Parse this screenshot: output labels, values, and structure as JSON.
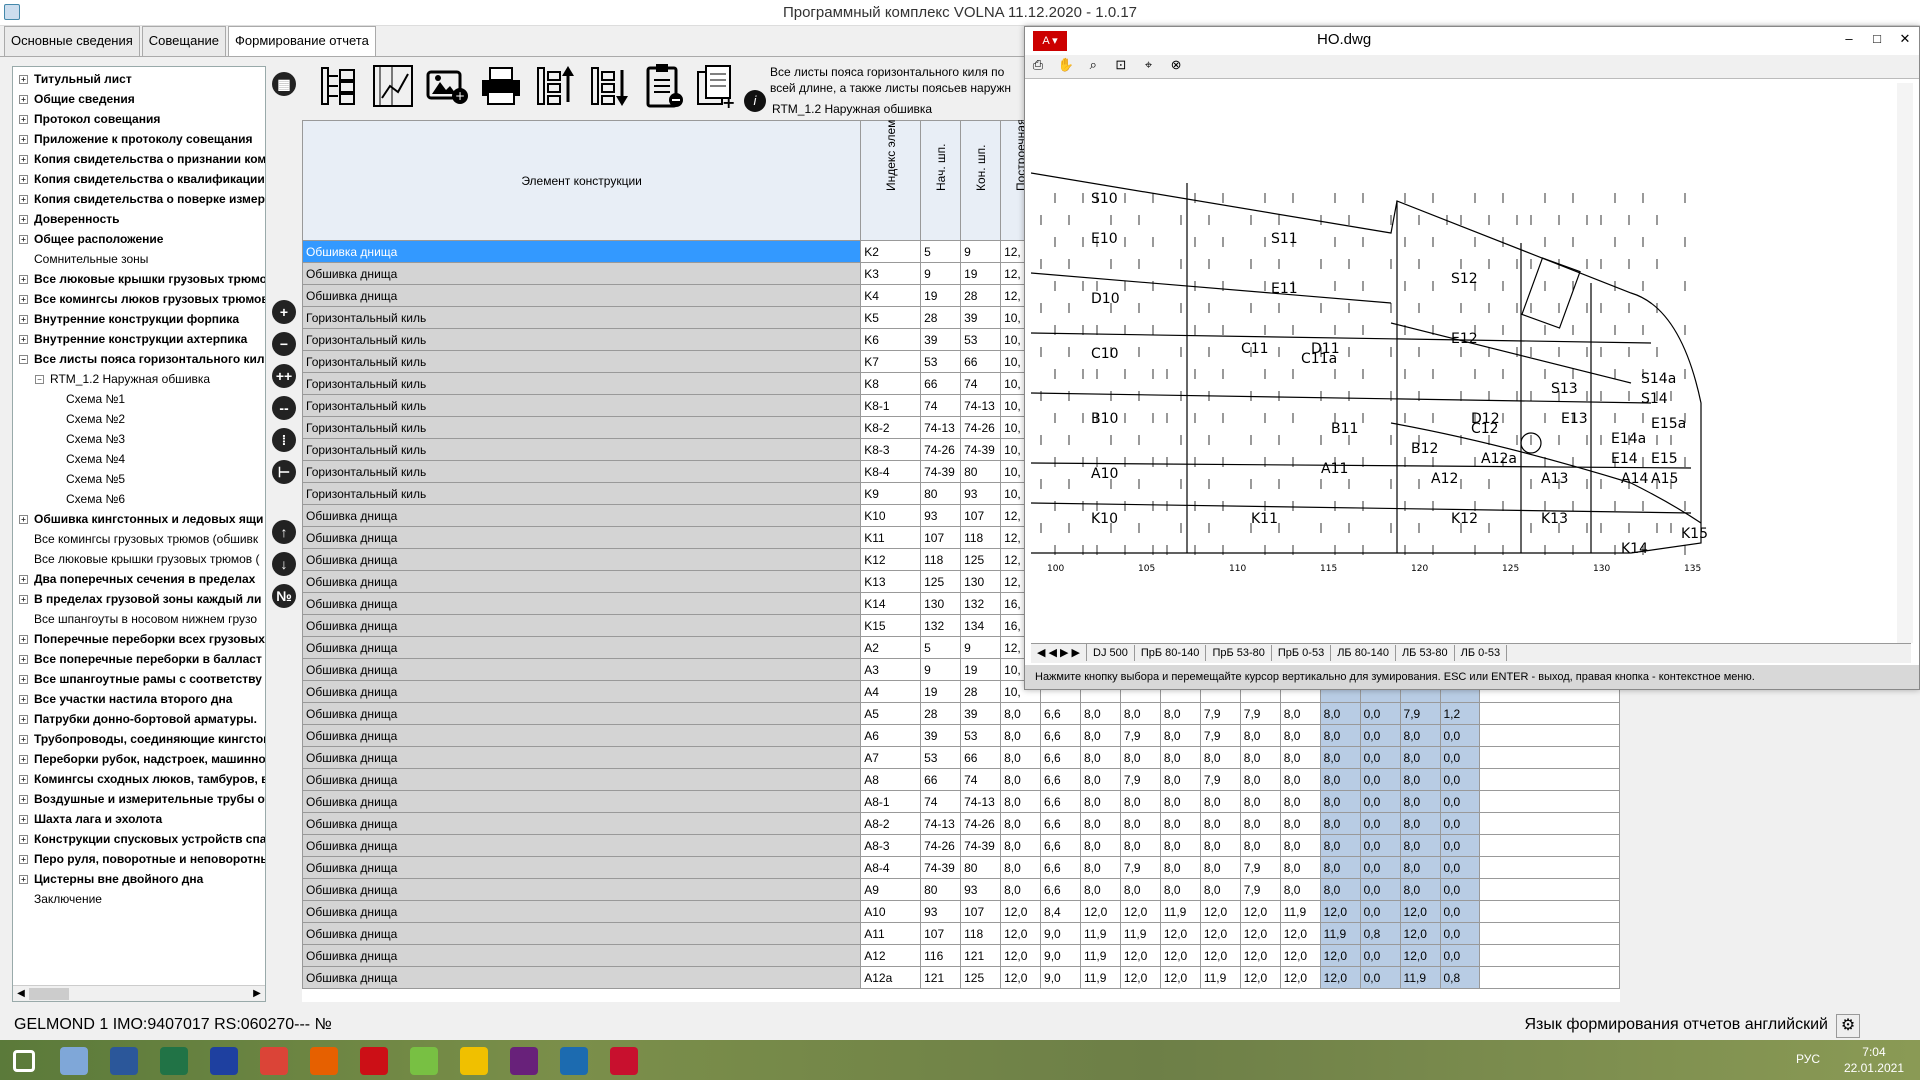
{
  "window": {
    "title": "Программный комплекс VOLNA 11.12.2020 - 1.0.17"
  },
  "tabs": [
    {
      "label": "Основные сведения"
    },
    {
      "label": "Совещание"
    },
    {
      "label": "Формирование отчета"
    }
  ],
  "tree": {
    "items": [
      {
        "label": "Титульный лист",
        "bold": true
      },
      {
        "label": "Общие сведения",
        "bold": true
      },
      {
        "label": "Протокол совещания",
        "bold": true
      },
      {
        "label": "Приложение к протоколу совещания",
        "bold": true
      },
      {
        "label": "Копия свидетельства о признании комп",
        "bold": true
      },
      {
        "label": "Копия свидетельства о квалификации",
        "bold": true
      },
      {
        "label": "Копия свидетельства о поверке измери",
        "bold": true
      },
      {
        "label": "Доверенность",
        "bold": true
      },
      {
        "label": "Общее расположение",
        "bold": true
      },
      {
        "label": "Сомнительные зоны",
        "bold": false
      },
      {
        "label": "Все люковые крышки грузовых трюмо",
        "bold": true
      },
      {
        "label": "Все комингсы люков грузовых трюмов",
        "bold": true
      },
      {
        "label": "Внутренние конструкции форпика",
        "bold": true
      },
      {
        "label": "Внутренние конструкции ахтерпика",
        "bold": true
      },
      {
        "label": "Все листы пояса горизонтального кил",
        "bold": true
      },
      {
        "label": "RTM_1.2 Наружная обшивка",
        "bold": false
      },
      {
        "label": "Схема №1",
        "bold": false
      },
      {
        "label": "Схема №2",
        "bold": false
      },
      {
        "label": "Схема №3",
        "bold": false
      },
      {
        "label": "Схема №4",
        "bold": false
      },
      {
        "label": "Схема №5",
        "bold": false
      },
      {
        "label": "Схема №6",
        "bold": false
      },
      {
        "label": "Обшивка кингстонных и ледовых ящи",
        "bold": true
      },
      {
        "label": "Все комингсы грузовых трюмов (обшивк",
        "bold": false
      },
      {
        "label": "Все люковые крышки грузовых трюмов (",
        "bold": false
      },
      {
        "label": "Два поперечных сечения в пределах",
        "bold": true
      },
      {
        "label": "В пределах грузовой зоны каждый ли",
        "bold": true
      },
      {
        "label": "Все шпангоуты в носовом нижнем грузо",
        "bold": false
      },
      {
        "label": "Поперечные переборки всех грузовых",
        "bold": true
      },
      {
        "label": "Все поперечные переборки в балласт",
        "bold": true
      },
      {
        "label": "Все шпангоутные рамы с соответству",
        "bold": true
      },
      {
        "label": "Все участки настила второго дна",
        "bold": true
      },
      {
        "label": "Патрубки донно-бортовой арматуры.",
        "bold": true
      },
      {
        "label": "Трубопроводы, соединяющие кингстон",
        "bold": true
      },
      {
        "label": "Переборки рубок, надстроек, машинно-",
        "bold": true
      },
      {
        "label": "Комингсы сходных люков, тамбуров, в",
        "bold": true
      },
      {
        "label": "Воздушные и измерительные трубы от",
        "bold": true
      },
      {
        "label": "Шахта лага и эхолота",
        "bold": true
      },
      {
        "label": "Конструкции спусковых устройств спас",
        "bold": true
      },
      {
        "label": "Перо руля, поворотные и неповоротны",
        "bold": true
      },
      {
        "label": "Цистерны вне двойного дна",
        "bold": true
      },
      {
        "label": "Заключение",
        "bold": false
      }
    ]
  },
  "toolbar": {
    "info_line1": "Все листы пояса горизонтального киля по",
    "info_line2": "всей длине, а также листы поясьев наружн",
    "info_sub": "RTM_1.2 Наружная обшивка",
    "info_icon": "i"
  },
  "side_buttons": [
    "▦",
    "+",
    "−",
    "++",
    "--",
    "⁞",
    "⊢",
    "↑",
    "↓",
    "№"
  ],
  "grid": {
    "headers": {
      "element": "Элемент конструкции",
      "index": "Индекс элемента",
      "start": "Нач. шп.",
      "end": "Кон. шп.",
      "build": "Построечная"
    },
    "rows": [
      {
        "el": "Обшивка днища",
        "idx": "K2",
        "a": "5",
        "b": "9",
        "c": "12,",
        "rest": []
      },
      {
        "el": "Обшивка днища",
        "idx": "K3",
        "a": "9",
        "b": "19",
        "c": "12,",
        "rest": []
      },
      {
        "el": "Обшивка днища",
        "idx": "K4",
        "a": "19",
        "b": "28",
        "c": "12,",
        "rest": []
      },
      {
        "el": "Горизонтальный киль",
        "idx": "K5",
        "a": "28",
        "b": "39",
        "c": "10,",
        "rest": []
      },
      {
        "el": "Горизонтальный киль",
        "idx": "K6",
        "a": "39",
        "b": "53",
        "c": "10,",
        "rest": []
      },
      {
        "el": "Горизонтальный киль",
        "idx": "K7",
        "a": "53",
        "b": "66",
        "c": "10,",
        "rest": []
      },
      {
        "el": "Горизонтальный киль",
        "idx": "K8",
        "a": "66",
        "b": "74",
        "c": "10,",
        "rest": []
      },
      {
        "el": "Горизонтальный киль",
        "idx": "K8-1",
        "a": "74",
        "b": "74-13",
        "c": "10,",
        "rest": []
      },
      {
        "el": "Горизонтальный киль",
        "idx": "K8-2",
        "a": "74-13",
        "b": "74-26",
        "c": "10,",
        "rest": []
      },
      {
        "el": "Горизонтальный киль",
        "idx": "K8-3",
        "a": "74-26",
        "b": "74-39",
        "c": "10,",
        "rest": []
      },
      {
        "el": "Горизонтальный киль",
        "idx": "K8-4",
        "a": "74-39",
        "b": "80",
        "c": "10,",
        "rest": []
      },
      {
        "el": "Горизонтальный киль",
        "idx": "K9",
        "a": "80",
        "b": "93",
        "c": "10,",
        "rest": []
      },
      {
        "el": "Обшивка днища",
        "idx": "K10",
        "a": "93",
        "b": "107",
        "c": "12,",
        "rest": []
      },
      {
        "el": "Обшивка днища",
        "idx": "K11",
        "a": "107",
        "b": "118",
        "c": "12,",
        "rest": []
      },
      {
        "el": "Обшивка днища",
        "idx": "K12",
        "a": "118",
        "b": "125",
        "c": "12,",
        "rest": []
      },
      {
        "el": "Обшивка днища",
        "idx": "K13",
        "a": "125",
        "b": "130",
        "c": "12,",
        "rest": []
      },
      {
        "el": "Обшивка днища",
        "idx": "K14",
        "a": "130",
        "b": "132",
        "c": "16,",
        "rest": []
      },
      {
        "el": "Обшивка днища",
        "idx": "K15",
        "a": "132",
        "b": "134",
        "c": "16,",
        "rest": []
      },
      {
        "el": "Обшивка днища",
        "idx": "A2",
        "a": "5",
        "b": "9",
        "c": "12,",
        "rest": []
      },
      {
        "el": "Обшивка днища",
        "idx": "A3",
        "a": "9",
        "b": "19",
        "c": "10,",
        "rest": []
      },
      {
        "el": "Обшивка днища",
        "idx": "A4",
        "a": "19",
        "b": "28",
        "c": "10,",
        "rest": []
      },
      {
        "el": "Обшивка днища",
        "idx": "A5",
        "a": "28",
        "b": "39",
        "c": "8,0",
        "rest": [
          "6,6",
          "8,0",
          "8,0",
          "8,0",
          "7,9",
          "7,9",
          "8,0",
          "8,0",
          "0,0",
          "7,9",
          "1,2"
        ]
      },
      {
        "el": "Обшивка днища",
        "idx": "A6",
        "a": "39",
        "b": "53",
        "c": "8,0",
        "rest": [
          "6,6",
          "8,0",
          "7,9",
          "8,0",
          "7,9",
          "8,0",
          "8,0",
          "8,0",
          "0,0",
          "8,0",
          "0,0"
        ]
      },
      {
        "el": "Обшивка днища",
        "idx": "A7",
        "a": "53",
        "b": "66",
        "c": "8,0",
        "rest": [
          "6,6",
          "8,0",
          "8,0",
          "8,0",
          "8,0",
          "8,0",
          "8,0",
          "8,0",
          "0,0",
          "8,0",
          "0,0"
        ]
      },
      {
        "el": "Обшивка днища",
        "idx": "A8",
        "a": "66",
        "b": "74",
        "c": "8,0",
        "rest": [
          "6,6",
          "8,0",
          "7,9",
          "8,0",
          "7,9",
          "8,0",
          "8,0",
          "8,0",
          "0,0",
          "8,0",
          "0,0"
        ]
      },
      {
        "el": "Обшивка днища",
        "idx": "A8-1",
        "a": "74",
        "b": "74-13",
        "c": "8,0",
        "rest": [
          "6,6",
          "8,0",
          "8,0",
          "8,0",
          "8,0",
          "8,0",
          "8,0",
          "8,0",
          "0,0",
          "8,0",
          "0,0"
        ]
      },
      {
        "el": "Обшивка днища",
        "idx": "A8-2",
        "a": "74-13",
        "b": "74-26",
        "c": "8,0",
        "rest": [
          "6,6",
          "8,0",
          "8,0",
          "8,0",
          "8,0",
          "8,0",
          "8,0",
          "8,0",
          "0,0",
          "8,0",
          "0,0"
        ]
      },
      {
        "el": "Обшивка днища",
        "idx": "A8-3",
        "a": "74-26",
        "b": "74-39",
        "c": "8,0",
        "rest": [
          "6,6",
          "8,0",
          "8,0",
          "8,0",
          "8,0",
          "8,0",
          "8,0",
          "8,0",
          "0,0",
          "8,0",
          "0,0"
        ]
      },
      {
        "el": "Обшивка днища",
        "idx": "A8-4",
        "a": "74-39",
        "b": "80",
        "c": "8,0",
        "rest": [
          "6,6",
          "8,0",
          "7,9",
          "8,0",
          "8,0",
          "7,9",
          "8,0",
          "8,0",
          "0,0",
          "8,0",
          "0,0"
        ]
      },
      {
        "el": "Обшивка днища",
        "idx": "A9",
        "a": "80",
        "b": "93",
        "c": "8,0",
        "rest": [
          "6,6",
          "8,0",
          "8,0",
          "8,0",
          "8,0",
          "7,9",
          "8,0",
          "8,0",
          "0,0",
          "8,0",
          "0,0"
        ]
      },
      {
        "el": "Обшивка днища",
        "idx": "A10",
        "a": "93",
        "b": "107",
        "c": "12,0",
        "rest": [
          "8,4",
          "12,0",
          "12,0",
          "11,9",
          "12,0",
          "12,0",
          "11,9",
          "12,0",
          "0,0",
          "12,0",
          "0,0"
        ]
      },
      {
        "el": "Обшивка днища",
        "idx": "A11",
        "a": "107",
        "b": "118",
        "c": "12,0",
        "rest": [
          "9,0",
          "11,9",
          "11,9",
          "12,0",
          "12,0",
          "12,0",
          "12,0",
          "11,9",
          "0,8",
          "12,0",
          "0,0"
        ]
      },
      {
        "el": "Обшивка днища",
        "idx": "A12",
        "a": "116",
        "b": "121",
        "c": "12,0",
        "rest": [
          "9,0",
          "11,9",
          "12,0",
          "12,0",
          "12,0",
          "12,0",
          "12,0",
          "12,0",
          "0,0",
          "12,0",
          "0,0"
        ]
      },
      {
        "el": "Обшивка днища",
        "idx": "A12a",
        "a": "121",
        "b": "125",
        "c": "12,0",
        "rest": [
          "9,0",
          "11,9",
          "12,0",
          "12,0",
          "11,9",
          "12,0",
          "12,0",
          "12,0",
          "0,0",
          "11,9",
          "0,8"
        ]
      }
    ]
  },
  "status": {
    "left": "GELMOND 1 IMO:9407017 RS:060270--- №",
    "right": "Язык формирования отчетов английский"
  },
  "dwg": {
    "title": "HO.dwg",
    "layout_tabs": [
      "DJ 500",
      "ПрБ 80-140",
      "ПрБ 53-80",
      "ПрБ 0-53",
      "ЛБ 80-140",
      "ЛБ 53-80",
      "ЛБ 0-53"
    ],
    "status": "Нажмите кнопку выбора и перемещайте курсор вертикально для зумирования. ESC или ENTER - выход, правая кнопка - контекстное меню.",
    "frame_labels": [
      "100",
      "105",
      "110",
      "115",
      "120",
      "125",
      "130",
      "135"
    ],
    "plate_labels": [
      "S10",
      "E10",
      "D10",
      "C10",
      "B10",
      "A10",
      "K10",
      "S11",
      "E11",
      "D11",
      "C11a",
      "C11",
      "B11",
      "A11",
      "K11",
      "S12",
      "E12",
      "D12",
      "C12",
      "B12",
      "A12",
      "A12a",
      "K12",
      "S13",
      "E13",
      "A13",
      "K13",
      "S14a",
      "S14",
      "E15a",
      "E14a",
      "E14",
      "E15",
      "A14",
      "A15",
      "K14",
      "K15"
    ]
  },
  "taskbar": {
    "apps": [
      "windows-start",
      "calculator",
      "word",
      "excel",
      "save-app",
      "chrome",
      "firefox",
      "opera",
      "utorrent",
      "archicad",
      "visual-studio",
      "volna",
      "autocad-viewer"
    ],
    "time": "7:04",
    "date": "22.01.2021",
    "lang": "РУС"
  }
}
